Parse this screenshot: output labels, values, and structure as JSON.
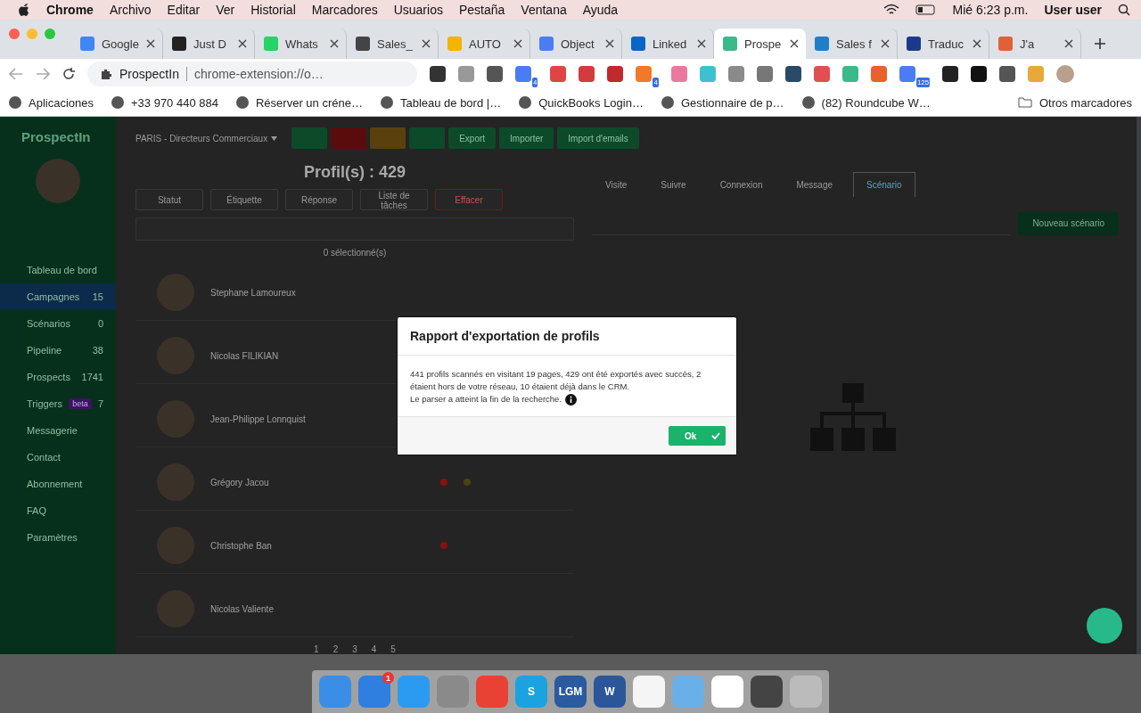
{
  "menu_bar": {
    "app": "Chrome",
    "items": [
      "Archivo",
      "Editar",
      "Ver",
      "Historial",
      "Marcadores",
      "Usuarios",
      "Pestaña",
      "Ventana",
      "Ayuda"
    ],
    "clock": "Mié 6:23 p.m.",
    "user": "User user"
  },
  "browser_tabs": [
    {
      "title": "Google",
      "color": "#4285f4",
      "selected": false
    },
    {
      "title": "Just D",
      "color": "#222222",
      "selected": false
    },
    {
      "title": "Whats",
      "color": "#25d366",
      "selected": false
    },
    {
      "title": "Sales_",
      "color": "#444444",
      "selected": false
    },
    {
      "title": "AUTO",
      "color": "#f4b400",
      "selected": false
    },
    {
      "title": "Object",
      "color": "#4a7cf3",
      "selected": false
    },
    {
      "title": "Linked",
      "color": "#0a66c2",
      "selected": false
    },
    {
      "title": "Prospe",
      "color": "#3cb98a",
      "selected": true
    },
    {
      "title": "Sales f",
      "color": "#1e7fc8",
      "selected": false
    },
    {
      "title": "Traduc",
      "color": "#1c3a8a",
      "selected": false
    },
    {
      "title": "J'a",
      "color": "#e0603a",
      "selected": false
    }
  ],
  "address_bar": {
    "site": "ProspectIn",
    "url": "chrome-extension://o…"
  },
  "extensions": [
    {
      "color": "#333333"
    },
    {
      "color": "#999999"
    },
    {
      "color": "#555555"
    },
    {
      "color": "#4a7cf3",
      "badge": "4"
    },
    {
      "color": "#e04545"
    },
    {
      "color": "#d33c3c"
    },
    {
      "color": "#c02a2a"
    },
    {
      "color": "#f07a2a",
      "badge": "4"
    },
    {
      "color": "#e87aa0"
    },
    {
      "color": "#3ec0d0"
    },
    {
      "color": "#8a8a8a"
    },
    {
      "color": "#777777"
    },
    {
      "color": "#2a4a6a"
    },
    {
      "color": "#e05050"
    },
    {
      "color": "#3cb98a"
    },
    {
      "color": "#e8622a"
    },
    {
      "color": "#4a7cf3",
      "badge": "125"
    },
    {
      "color": "#222222"
    },
    {
      "color": "#111111"
    },
    {
      "color": "#555555"
    },
    {
      "color": "#e8a83a"
    }
  ],
  "bookmarks": [
    "Aplicaciones",
    "+33 970 440 884",
    "Réserver un créne…",
    "Tableau de bord |…",
    "QuickBooks Login…",
    "Gestionnaire de p…",
    "(82) Roundcube W…"
  ],
  "other_bookmarks": "Otros marcadores",
  "sidebar": {
    "logo": "ProspectIn",
    "items": [
      {
        "label": "Tableau de bord",
        "selected": false
      },
      {
        "label": "Campagnes",
        "count": "15",
        "selected": true
      },
      {
        "label": "Scénarios",
        "count": "0",
        "selected": false
      },
      {
        "label": "Pipeline",
        "count": "38",
        "selected": false
      },
      {
        "label": "Prospects",
        "count": "1741",
        "selected": false
      },
      {
        "label": "Triggers",
        "badge": "beta",
        "count": "7",
        "selected": false
      },
      {
        "label": "Messagerie",
        "selected": false
      },
      {
        "label": "Contact",
        "selected": false
      },
      {
        "label": "Abonnement",
        "selected": false
      },
      {
        "label": "FAQ",
        "selected": false
      },
      {
        "label": "Paramètres",
        "selected": false
      }
    ]
  },
  "toolbar": {
    "campaign": "PARIS - Directeurs Commerciaux",
    "buttons": [
      {
        "kind": "icon",
        "color": "#0c4a2a"
      },
      {
        "kind": "icon",
        "color": "#5a0c0c"
      },
      {
        "kind": "icon",
        "color": "#5a400c"
      },
      {
        "kind": "icon",
        "color": "#0c4a2a"
      },
      {
        "kind": "text",
        "label": "Export",
        "color": "#0c4a2a"
      },
      {
        "kind": "text",
        "label": "Importer",
        "color": "#0c4a2a"
      },
      {
        "kind": "text",
        "label": "Import d'emails",
        "color": "#0c4a2a"
      }
    ]
  },
  "profiles_title": "Profil(s) : 429",
  "filters": [
    "Statut",
    "Étiquette",
    "Réponse",
    "Liste de tâches"
  ],
  "clear_button": "Effacer",
  "selection": "0 sélectionné(s)",
  "profiles": [
    {
      "name": "Stephane Lamoureux"
    },
    {
      "name": "Nicolas FILIKIAN"
    },
    {
      "name": "Jean-Philippe Lonnquist"
    },
    {
      "name": "Grégory Jacou",
      "dots": [
        {
          "color": "#8a0f0f"
        },
        {
          "color": "#4a4212"
        }
      ]
    },
    {
      "name": "Christophe Ban",
      "dots": [
        {
          "color": "#8a0f0f"
        }
      ]
    },
    {
      "name": "Nicolas Valiente"
    }
  ],
  "pagination": [
    "1",
    "2",
    "3",
    "4",
    "5"
  ],
  "right_tabs": [
    {
      "label": "Visite",
      "selected": false
    },
    {
      "label": "Suivre",
      "selected": false
    },
    {
      "label": "Connexion",
      "selected": false
    },
    {
      "label": "Message",
      "selected": false
    },
    {
      "label": "Scénario",
      "selected": true
    }
  ],
  "new_scenario_button": "Nouveau scénario",
  "dialog": {
    "title": "Rapport d'exportation de profils",
    "lines": [
      "441 profils scannés en visitant 19 pages, 429 ont été exportés avec succès, 2 étaient hors de votre réseau, 10 étaient déjà dans le CRM.",
      "Le parser a atteint la fin de la recherche."
    ],
    "ok": "Ok"
  },
  "dock": [
    {
      "color": "#3a8ee6"
    },
    {
      "color": "#2f7fe0",
      "badge": "1"
    },
    {
      "color": "#2a9bf0"
    },
    {
      "color": "#8a8a8a"
    },
    {
      "color": "#e94235"
    },
    {
      "color": "#1aa3e0",
      "letter": "S"
    },
    {
      "color": "#2a5aa0",
      "letter": "LGM"
    },
    {
      "color": "#2b579a",
      "letter": "W"
    },
    {
      "color": "#f5f5f5"
    },
    {
      "color": "#6ab0e8"
    },
    {
      "color": "#ffffff"
    },
    {
      "color": "#444444"
    },
    {
      "color": "#bbbbbb"
    }
  ]
}
